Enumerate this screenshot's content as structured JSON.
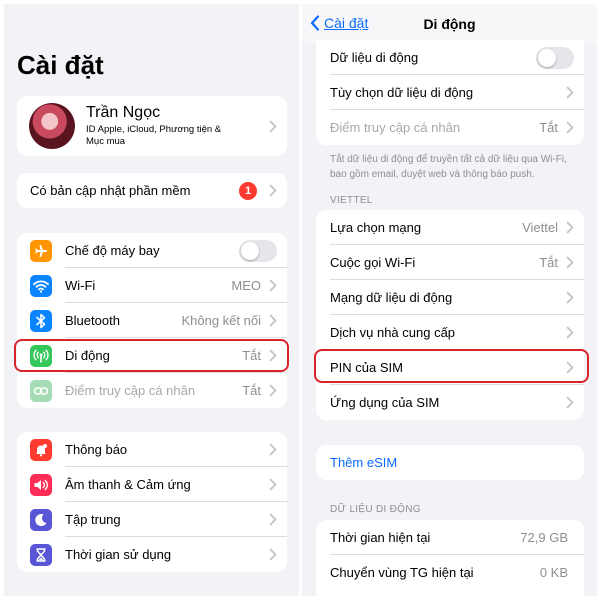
{
  "left": {
    "title": "Cài đặt",
    "profile": {
      "name": "Trần Ngọc",
      "subtitle_line1": "ID Apple, iCloud, Phương tiện &",
      "subtitle_line2": "Mục mua"
    },
    "update": {
      "label": "Có bản cập nhật phần mềm",
      "badge": "1"
    },
    "network_items": [
      {
        "label": "Chế độ máy bay",
        "icon": "airplane-icon",
        "color": "#ff9500",
        "toggle": false
      },
      {
        "label": "Wi-Fi",
        "icon": "wifi-icon",
        "color": "#0a84ff",
        "value": "MEO"
      },
      {
        "label": "Bluetooth",
        "icon": "bluetooth-icon",
        "color": "#0a84ff",
        "value": "Không kết nối"
      },
      {
        "label": "Di động",
        "icon": "cellular-icon",
        "color": "#34c759",
        "value": "Tắt",
        "highlighted": true
      },
      {
        "label": "Điểm truy cập cá nhân",
        "icon": "hotspot-icon",
        "color": "#a6dcb3",
        "value": "Tắt",
        "disabled": true
      }
    ],
    "general_items": [
      {
        "label": "Thông báo",
        "icon": "notification-icon",
        "color": "#ff3b30"
      },
      {
        "label": "Âm thanh & Cảm ứng",
        "icon": "sound-icon",
        "color": "#ff2d55"
      },
      {
        "label": "Tập trung",
        "icon": "moon-icon",
        "color": "#5856d6"
      },
      {
        "label": "Thời gian sử dụng",
        "icon": "hourglass-icon",
        "color": "#5856d6"
      }
    ]
  },
  "right": {
    "nav": {
      "back_label": "Cài đặt",
      "title": "Di động"
    },
    "top_items": [
      {
        "label": "Dữ liệu di động",
        "toggle": false
      },
      {
        "label": "Tùy chọn dữ liệu di động"
      },
      {
        "label": "Điểm truy cập cá nhân",
        "value": "Tắt",
        "disabled": true
      }
    ],
    "footnote": "Tắt dữ liệu di động để truyền tất cả dữ liệu qua Wi-Fi, bao gồm email, duyệt web và thông báo push.",
    "carrier_header": "VIETTEL",
    "carrier_items": [
      {
        "label": "Lựa chọn mạng",
        "value": "Viettel"
      },
      {
        "label": "Cuộc gọi Wi-Fi",
        "value": "Tắt"
      },
      {
        "label": "Mạng dữ liệu di động"
      },
      {
        "label": "Dịch vụ nhà cung cấp"
      },
      {
        "label": "PIN của SIM",
        "highlighted": true
      },
      {
        "label": "Ứng dụng của SIM"
      }
    ],
    "esim_label": "Thêm eSIM",
    "data_header": "DỮ LIỆU DI ĐỘNG",
    "data_items": [
      {
        "label": "Thời gian hiện tại",
        "value": "72,9 GB"
      },
      {
        "label": "Chuyển vùng TG hiện tại",
        "value": "0 KB"
      }
    ]
  }
}
